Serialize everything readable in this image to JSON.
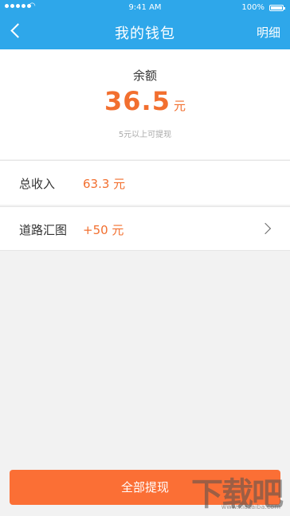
{
  "status_bar": {
    "time": "9:41 AM",
    "battery": "100%"
  },
  "nav": {
    "title": "我的钱包",
    "detail_label": "明细"
  },
  "balance": {
    "label": "余额",
    "amount": "36.5",
    "unit": "元",
    "hint": "5元以上可提现"
  },
  "rows": [
    {
      "name": "总收入",
      "value": "63.3 元"
    },
    {
      "name": "道路汇图",
      "value": "+50 元"
    }
  ],
  "withdraw_button": "全部提现",
  "watermark": {
    "text": "下载吧",
    "url": "www.xiazaiba.com"
  },
  "colors": {
    "nav_bg": "#2ea7ea",
    "accent": "#f26f2f",
    "button_bg": "#fb6f35"
  }
}
